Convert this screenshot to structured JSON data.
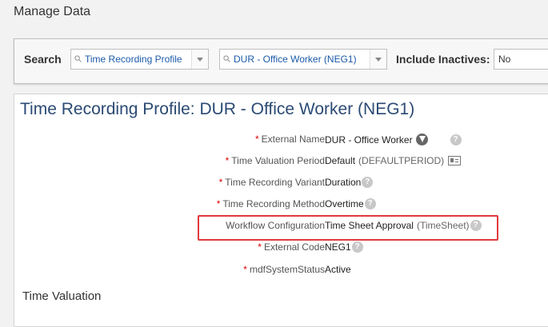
{
  "header": {
    "title": "Manage Data"
  },
  "search": {
    "label": "Search",
    "object_type": "Time Recording Profile",
    "object_value": "DUR - Office Worker (NEG1)",
    "include_inactives_label": "Include Inactives:",
    "include_inactives_value": "No"
  },
  "record": {
    "title": "Time Recording Profile: DUR - Office Worker (NEG1)",
    "fields": [
      {
        "label": "External Name",
        "required": "*",
        "value": "DUR - Office Worker",
        "sub": ""
      },
      {
        "label": "Time Valuation Period",
        "required": "*",
        "value": "Default",
        "sub": "(DEFAULTPERIOD)"
      },
      {
        "label": "Time Recording Variant",
        "required": "*",
        "value": "Duration",
        "sub": ""
      },
      {
        "label": "Time Recording Method",
        "required": "*",
        "value": "Overtime",
        "sub": ""
      },
      {
        "label": "Workflow Configuration",
        "required": "",
        "value": "Time Sheet Approval",
        "sub": "(TimeSheet)"
      },
      {
        "label": "External Code",
        "required": "*",
        "value": "NEG1",
        "sub": ""
      },
      {
        "label": "mdfSystemStatus",
        "required": "*",
        "value": "Active",
        "sub": ""
      }
    ],
    "section_title": "Time Valuation"
  },
  "colors": {
    "highlight": "#e0393e",
    "title": "#2b4a74",
    "link": "#1a5aa8",
    "required": "#dd0000"
  },
  "icons": [
    "search-icon",
    "dropdown-arrow-icon",
    "translate-globe-icon",
    "help-icon",
    "details-card-icon"
  ]
}
